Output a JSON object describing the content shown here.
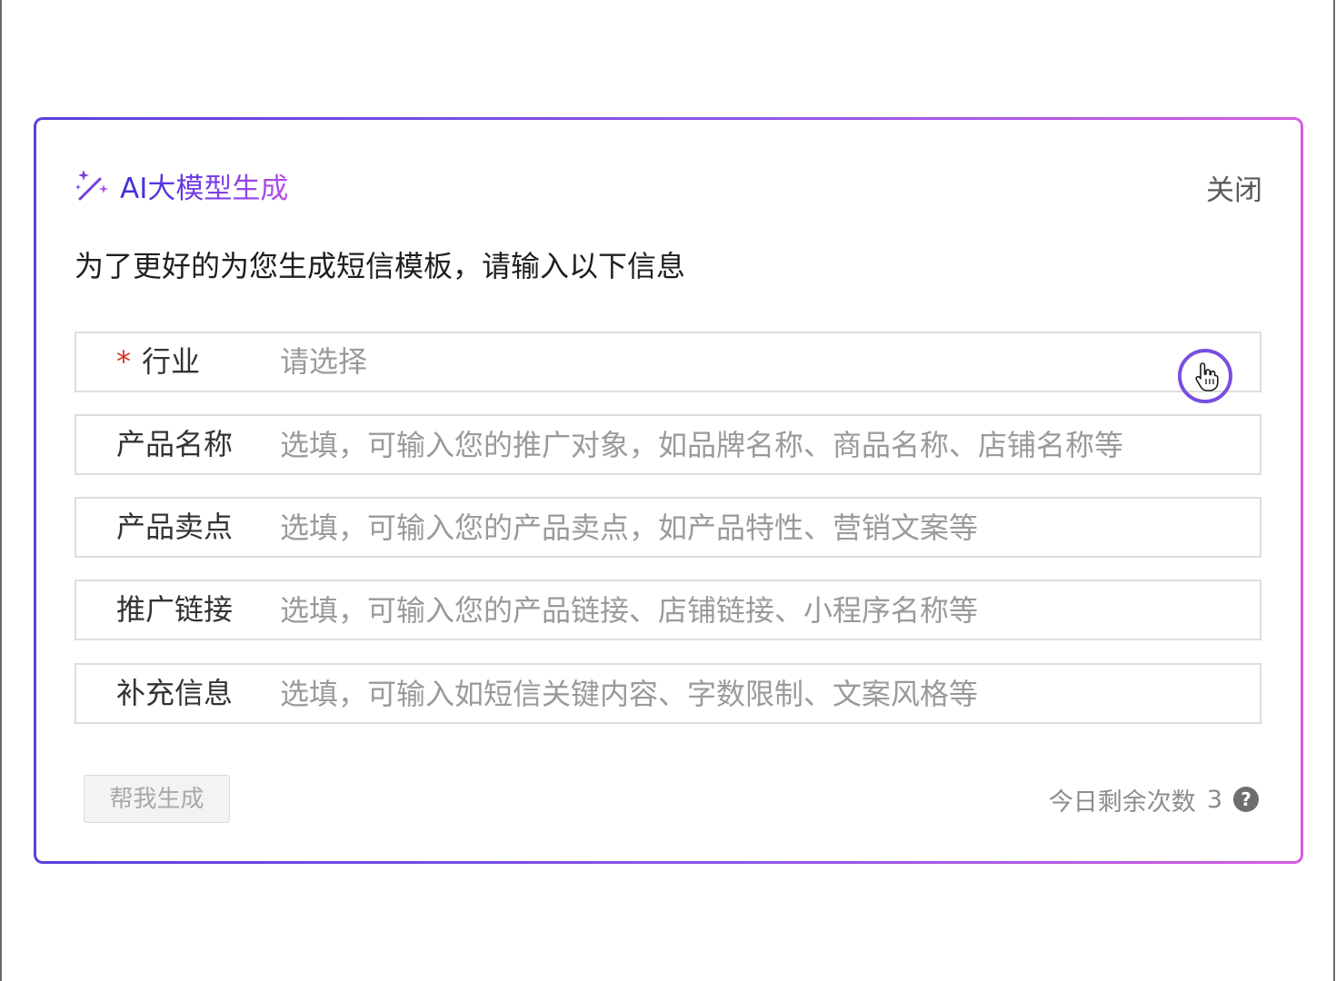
{
  "dialog": {
    "title": "AI大模型生成",
    "close_label": "关闭",
    "intro": "为了更好的为您生成短信模板，请输入以下信息",
    "icons": {
      "title_icon": "magic-wand-icon",
      "help_icon": "question-circle-icon",
      "cursor": "hand-pointer-icon"
    },
    "colors": {
      "title_gradient_start": "#3b2fd8",
      "title_gradient_end": "#b54ee6",
      "required": "#d93026",
      "cursor_ring": "#7a4fe0"
    }
  },
  "form": {
    "industry": {
      "required_mark": "*",
      "label": "行业",
      "value": "请选择"
    },
    "product_name": {
      "label": "产品名称",
      "placeholder": "选填，可输入您的推广对象，如品牌名称、商品名称、店铺名称等"
    },
    "selling_point": {
      "label": "产品卖点",
      "placeholder": "选填，可输入您的产品卖点，如产品特性、营销文案等"
    },
    "promo_link": {
      "label": "推广链接",
      "placeholder": "选填，可输入您的产品链接、店铺链接、小程序名称等"
    },
    "extra_info": {
      "label": "补充信息",
      "placeholder": "选填，可输入如短信关键内容、字数限制、文案风格等"
    }
  },
  "footer": {
    "generate_label": "帮我生成",
    "quota_label": "今日剩余次数",
    "quota_count": "3",
    "help_glyph": "?"
  }
}
